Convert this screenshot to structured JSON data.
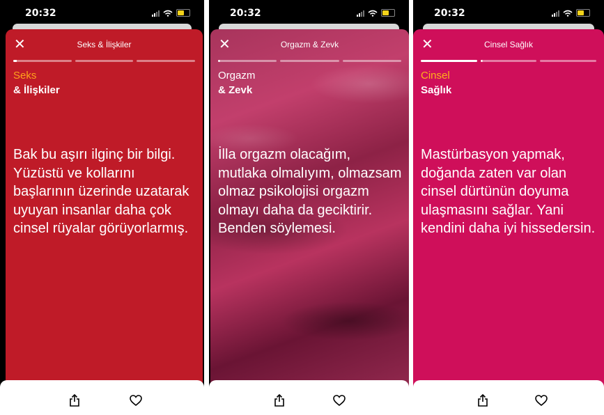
{
  "screens": [
    {
      "status_time": "20:32",
      "header_title": "Seks & İlişkiler",
      "category_line1": "Seks",
      "category_line2": "& İlişkiler",
      "body_text": "Bak bu aşırı ilginç bir bilgi. Yüzüstü ve kollarını başlarının üzerinde uzatarak uyuyan insanlar daha çok cinsel rüyalar görüyorlarmış.",
      "progress": [
        0.06,
        0,
        0
      ],
      "colors": {
        "card": "#bf1b28",
        "category": "#ffa21c"
      }
    },
    {
      "status_time": "20:32",
      "header_title": "Orgazm & Zevk",
      "category_line1": "Orgazm",
      "category_line2": "& Zevk",
      "body_text": "İlla orgazm olacağım, mutlaka olmalıyım, olmazsam olmaz psikolojisi orgazm olmayı daha da geciktirir. Benden söylemesi.",
      "progress": [
        0.02,
        0,
        0
      ],
      "colors": {
        "card": "#b0325c",
        "category": "#ffffff"
      }
    },
    {
      "status_time": "20:32",
      "header_title": "Cinsel Sağlık",
      "category_line1": "Cinsel",
      "category_line2": "Sağlık",
      "body_text": "Mastürbasyon yapmak, doğanda zaten var olan cinsel dürtünün doyuma ulaşmasını sağlar. Yani kendini daha iyi hissedersin.",
      "progress": [
        1,
        0.02,
        0
      ],
      "colors": {
        "card": "#cf0f5a",
        "category": "#ffb21a"
      }
    }
  ],
  "icons": {
    "close": "close-icon",
    "share": "share-icon",
    "like": "heart-icon"
  }
}
